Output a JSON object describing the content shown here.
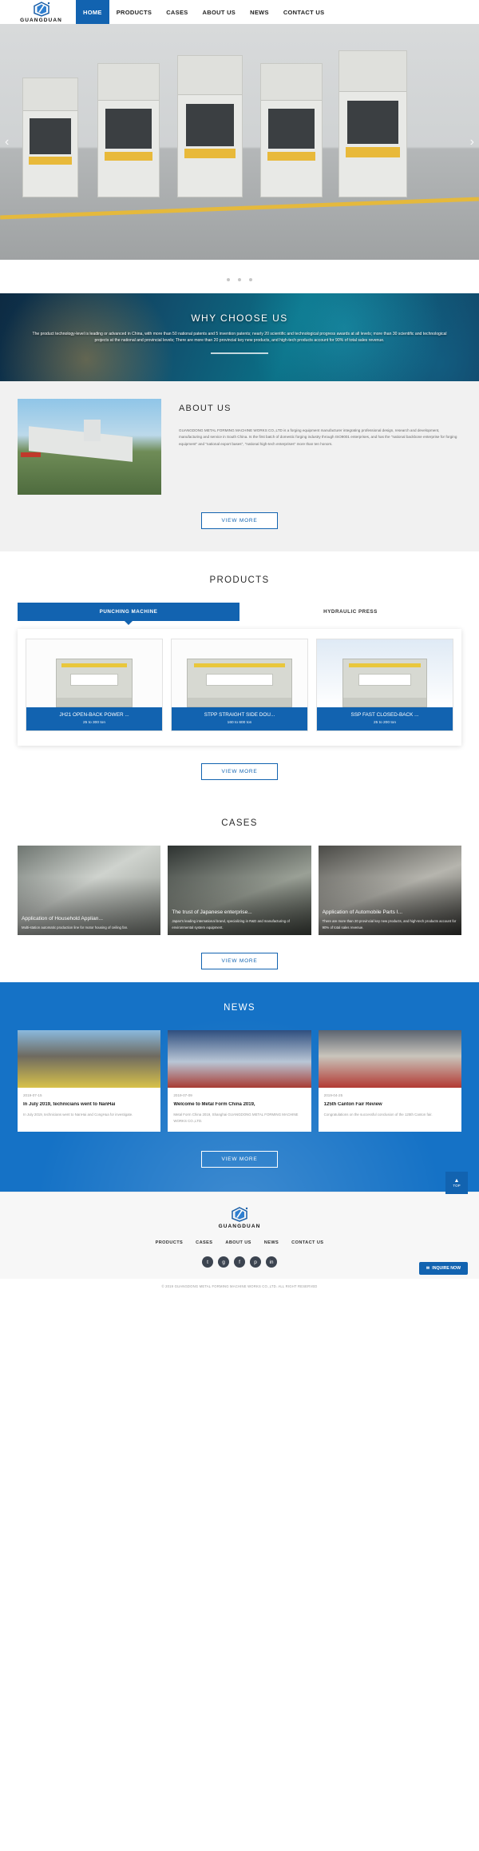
{
  "brand": {
    "name": "GUANGDUAN",
    "logo_icon": "hexagon-logo-icon"
  },
  "nav": {
    "items": [
      {
        "label": "HOME",
        "active": true
      },
      {
        "label": "PRODUCTS",
        "active": false
      },
      {
        "label": "CASES",
        "active": false
      },
      {
        "label": "ABOUT US",
        "active": false
      },
      {
        "label": "NEWS",
        "active": false
      },
      {
        "label": "CONTACT US",
        "active": false
      }
    ]
  },
  "hero": {
    "prev_icon": "chevron-left-icon",
    "next_icon": "chevron-right-icon",
    "dots": 3
  },
  "why": {
    "title": "WHY CHOOSE US",
    "description": "The product technology-level is leading or advanced in China, with more than 50 national patents and 5 invention patents; nearly 20 scientific and technological progress awards at all levels; more than 30 scientific and technological projects at the national and provincial levels; There are more than 20 provincial key new products, and high-tech products account for 90% of total sales revenue."
  },
  "about": {
    "title": "ABOUT US",
    "description": "GUANGDONG METAL FORMING MACHINE WORKS CO.,LTD is a forging equipment manufacturer integrating professional design, research and development, manufacturing and service in South China. Is the first batch of domestic forging industry through ISO9001 enterprises, and has the \"national backbone enterprise for forging equipment\" and \"national export bases\", \"national high-tech enterprises\" more than ten honors.",
    "view_more": "VIEW MORE"
  },
  "products": {
    "title": "PRODUCTS",
    "tabs": [
      {
        "label": "PUNCHING MACHINE",
        "active": true
      },
      {
        "label": "HYDRAULIC PRESS",
        "active": false
      }
    ],
    "items": [
      {
        "title": "JH21 OPEN-BACK POWER ...",
        "spec": "25 to 300 ton"
      },
      {
        "title": "STPP STRAIGHT SIDE DOU...",
        "spec": "160 to 600 ton"
      },
      {
        "title": "SSP FAST CLOSED-BACK ...",
        "spec": "25 to 200 ton"
      }
    ],
    "view_more": "VIEW MORE"
  },
  "cases": {
    "title": "CASES",
    "items": [
      {
        "title": "Application of Household Applian...",
        "desc": "Multi-station automatic production line for motor housing of ceiling fan."
      },
      {
        "title": "The trust of Japanese enterprise...",
        "desc": "Japan's leading international brand, specializing in R&D and manufacturing of environmental system equipment."
      },
      {
        "title": "Application of Automobile Parts I...",
        "desc": "There are more than 20 provincial key new products, and high-tech products account for 90% of total sales revenue."
      }
    ],
    "view_more": "VIEW MORE"
  },
  "news": {
    "title": "NEWS",
    "items": [
      {
        "date": "2019-07-15",
        "title": "In July 2019, technicians went to NanHai",
        "desc": "In July 2019, technicians went to NanHai and CongHua for investigate."
      },
      {
        "date": "2019-07-09",
        "title": "Welcome to Metal Form China 2019,",
        "desc": "Metal Form China 2019, Shanghai GUANGDONG METAL FORMING MACHINE WORKS CO.,LTD."
      },
      {
        "date": "2019-04-25",
        "title": "125th Canton Fair Review",
        "desc": "Congratulations on the successful conclusion of the 125th Canton fair."
      }
    ],
    "view_more": "VIEW MORE"
  },
  "footer": {
    "nav": [
      "PRODUCTS",
      "CASES",
      "ABOUT US",
      "NEWS",
      "CONTACT US"
    ],
    "social": [
      {
        "name": "twitter-icon",
        "glyph": "t"
      },
      {
        "name": "google-plus-icon",
        "glyph": "g"
      },
      {
        "name": "facebook-icon",
        "glyph": "f"
      },
      {
        "name": "pinterest-icon",
        "glyph": "p"
      },
      {
        "name": "linkedin-icon",
        "glyph": "in"
      }
    ],
    "copyright": "© 2019 GUANGDONG METAL FORMING MACHINE WORKS CO.,LTD. ALL RIGHT RESERVED",
    "to_top": "TOP",
    "inquire": "INQUIRE NOW"
  },
  "colors": {
    "accent": "#1263b0",
    "news_bg": "#1572c6"
  }
}
